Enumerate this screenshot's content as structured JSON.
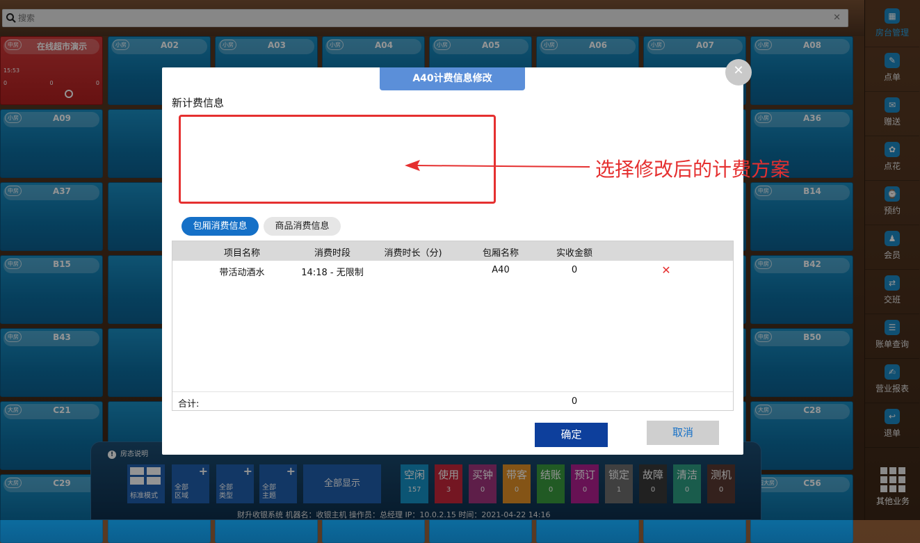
{
  "search": {
    "placeholder": "搜索"
  },
  "rooms": [
    {
      "type": "中房",
      "name": "在线超市演示",
      "red": true,
      "time": "15:53",
      "n1": "0",
      "n2": "0",
      "n3": "0"
    },
    {
      "type": "小房",
      "name": "A02"
    },
    {
      "type": "小房",
      "name": "A03"
    },
    {
      "type": "小房",
      "name": "A04"
    },
    {
      "type": "小房",
      "name": "A05"
    },
    {
      "type": "小房",
      "name": "A06"
    },
    {
      "type": "小房",
      "name": "A07"
    },
    {
      "type": "小房",
      "name": "A08"
    },
    {
      "type": "小房",
      "name": "A09"
    },
    {
      "type": "小房",
      "name": "A36"
    },
    {
      "type": "中房",
      "name": "A37"
    },
    {
      "type": "中房",
      "name": "B14"
    },
    {
      "type": "中房",
      "name": "B15"
    },
    {
      "type": "中房",
      "name": "B42"
    },
    {
      "type": "中房",
      "name": "B43"
    },
    {
      "type": "中房",
      "name": "B50"
    },
    {
      "type": "大房",
      "name": "C21"
    },
    {
      "type": "大房",
      "name": "C28"
    },
    {
      "type": "大房",
      "name": "C29"
    },
    {
      "type": "超大房",
      "name": "C56"
    }
  ],
  "sidebar": {
    "items": [
      {
        "label": "房台管理",
        "icon": "grid-icon"
      },
      {
        "label": "点单",
        "icon": "order-icon"
      },
      {
        "label": "赠送",
        "icon": "gift-icon"
      },
      {
        "label": "点花",
        "icon": "flower-icon"
      },
      {
        "label": "预约",
        "icon": "reserve-icon"
      },
      {
        "label": "会员",
        "icon": "member-icon"
      },
      {
        "label": "交班",
        "icon": "shift-icon"
      },
      {
        "label": "账单查询",
        "icon": "bill-icon"
      },
      {
        "label": "营业报表",
        "icon": "report-icon"
      },
      {
        "label": "退单",
        "icon": "refund-icon"
      }
    ],
    "other_label": "其他业务"
  },
  "bottombar": {
    "legend_label": "房态说明",
    "mode_label": "标准模式",
    "all_area": "全部\n区域",
    "all_type": "全部\n类型",
    "all_theme": "全部\n主题",
    "show_all": "全部显示",
    "statuses": [
      {
        "label": "空闲",
        "count": "157",
        "color": "#1593c9"
      },
      {
        "label": "使用",
        "count": "3",
        "color": "#c8273b"
      },
      {
        "label": "买钟",
        "count": "0",
        "color": "#a3347e"
      },
      {
        "label": "带客",
        "count": "0",
        "color": "#e39226"
      },
      {
        "label": "结账",
        "count": "0",
        "color": "#3a9b3f"
      },
      {
        "label": "预订",
        "count": "0",
        "color": "#b11f91"
      },
      {
        "label": "锁定",
        "count": "1",
        "color": "#6f6f6f"
      },
      {
        "label": "故障",
        "count": "0",
        "color": "#3a3a3a"
      },
      {
        "label": "清洁",
        "count": "0",
        "color": "#2e9f84"
      },
      {
        "label": "测机",
        "count": "0",
        "color": "#5a3a32"
      }
    ],
    "footer": "财升收银系统      机器名：收银主机    操作员：总经理    IP：10.0.2.15    时间：2021-04-22 14:16"
  },
  "modal": {
    "title": "A40计费信息修改",
    "section_label": "新计费信息",
    "tabs": [
      {
        "label": "包厢消费信息",
        "active": true
      },
      {
        "label": "商品消费信息",
        "active": false
      }
    ],
    "columns": [
      "项目名称",
      "消费时段",
      "消费时长（分)",
      "包厢名称",
      "实收金额"
    ],
    "rows": [
      {
        "item": "带活动酒水",
        "period": "14:18 - 无限制",
        "duration": "",
        "room": "A40",
        "amount": "0"
      }
    ],
    "total_label": "合计:",
    "total_amount": "0",
    "ok_label": "确定",
    "cancel_label": "取消"
  },
  "annotation": {
    "text": "选择修改后的计费方案",
    "color": "#e53030"
  }
}
